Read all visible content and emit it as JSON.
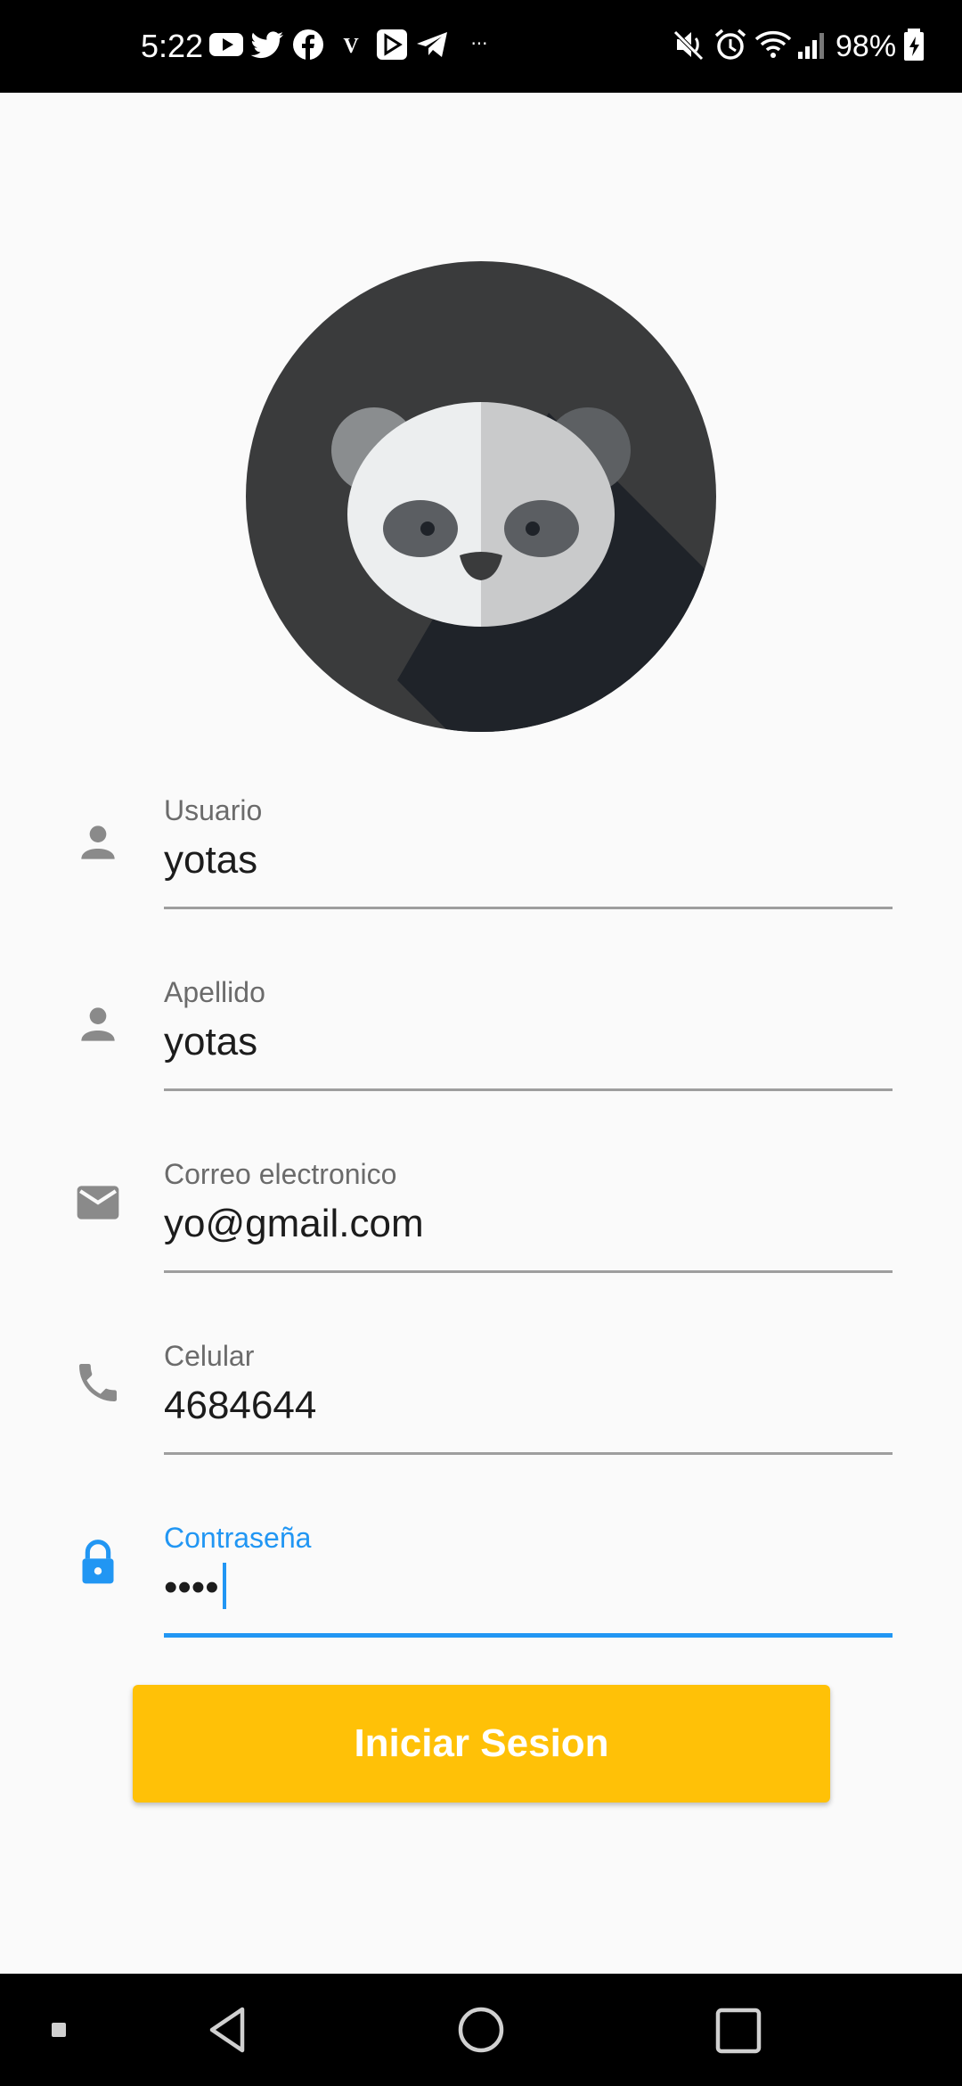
{
  "status_bar": {
    "time": "5:22",
    "battery": "98%",
    "app_icons": [
      "youtube-icon",
      "twitter-icon",
      "facebook-icon",
      "v-icon",
      "play-games-icon",
      "telegram-icon",
      "more-dots-icon"
    ],
    "system_icons": [
      "mute-icon",
      "alarm-icon",
      "wifi-icon",
      "signal-icon",
      "battery-icon"
    ],
    "v_glyph": "V",
    "more_glyph": "···"
  },
  "avatar": {
    "description_icon": "panda-avatar-icon"
  },
  "form": {
    "fields": [
      {
        "label": "Usuario",
        "value": "yotas",
        "icon": "person-icon"
      },
      {
        "label": "Apellido",
        "value": "yotas",
        "icon": "person-icon"
      },
      {
        "label": "Correo electronico",
        "value": "yo@gmail.com",
        "icon": "email-icon"
      },
      {
        "label": "Celular",
        "value": "4684644",
        "icon": "phone-icon"
      },
      {
        "label": "Contraseña",
        "value": "••••",
        "icon": "lock-icon",
        "focused": true
      }
    ],
    "submit_label": "Iniciar Sesion"
  },
  "colors": {
    "accent": "#2196f3",
    "button": "#ffc107",
    "background": "#fafafa"
  },
  "nav_bar": {
    "items": [
      "recents-dot-icon",
      "back-icon",
      "home-icon",
      "overview-icon"
    ]
  }
}
